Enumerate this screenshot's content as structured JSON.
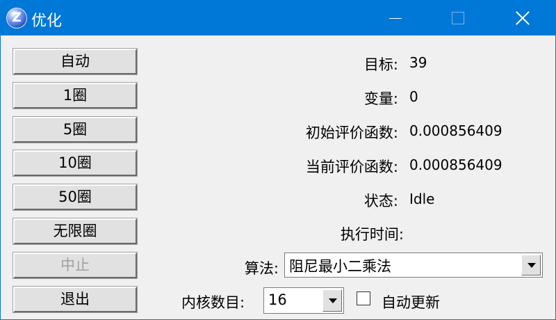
{
  "window": {
    "title": "优化",
    "icon": "z-logo-icon",
    "icon_letter": "Z",
    "accent": "#0078d7"
  },
  "buttons": [
    {
      "label": "自动",
      "enabled": true
    },
    {
      "label": "1圈",
      "enabled": true
    },
    {
      "label": "5圈",
      "enabled": true
    },
    {
      "label": "10圈",
      "enabled": true
    },
    {
      "label": "50圈",
      "enabled": true
    },
    {
      "label": "无限圈",
      "enabled": true
    },
    {
      "label": "中止",
      "enabled": false
    },
    {
      "label": "退出",
      "enabled": true
    }
  ],
  "info": {
    "target_label": "目标:",
    "target_value": "39",
    "variables_label": "变量:",
    "variables_value": "0",
    "initial_eval_label": "初始评价函数:",
    "initial_eval_value": "0.000856409",
    "current_eval_label": "当前评价函数:",
    "current_eval_value": "0.000856409",
    "status_label": "状态:",
    "status_value": "Idle",
    "exec_time_label": "执行时间:"
  },
  "algorithm": {
    "label": "算法:",
    "selected": "阻尼最小二乘法"
  },
  "cores": {
    "label": "内核数目:",
    "selected": "16"
  },
  "auto_update": {
    "label": "自动更新",
    "checked": false
  }
}
